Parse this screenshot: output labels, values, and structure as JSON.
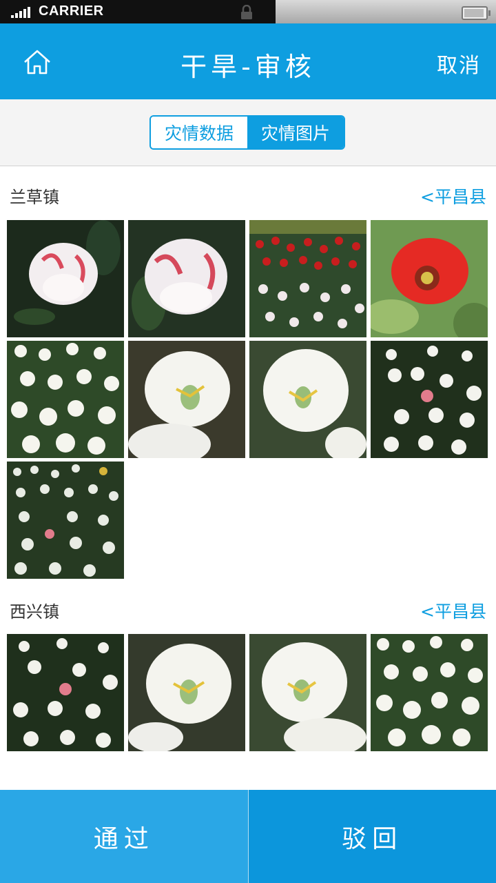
{
  "status_bar": {
    "carrier": "CARRIER"
  },
  "header": {
    "title": "干旱-审核",
    "cancel_label": "取消"
  },
  "segments": [
    {
      "label": "灾情数据",
      "selected": false
    },
    {
      "label": "灾情图片",
      "selected": true
    }
  ],
  "sections": [
    {
      "title": "兰草镇",
      "link": "<平昌县",
      "photo_count": 9
    },
    {
      "title": "西兴镇",
      "link": "<平昌县",
      "photo_count": 4
    }
  ],
  "actions": {
    "pass_label": "通过",
    "reject_label": "驳回"
  },
  "colors": {
    "accent": "#0e9ee0",
    "pass_bg": "#2aa7e6",
    "reject_bg": "#0c96dc"
  }
}
